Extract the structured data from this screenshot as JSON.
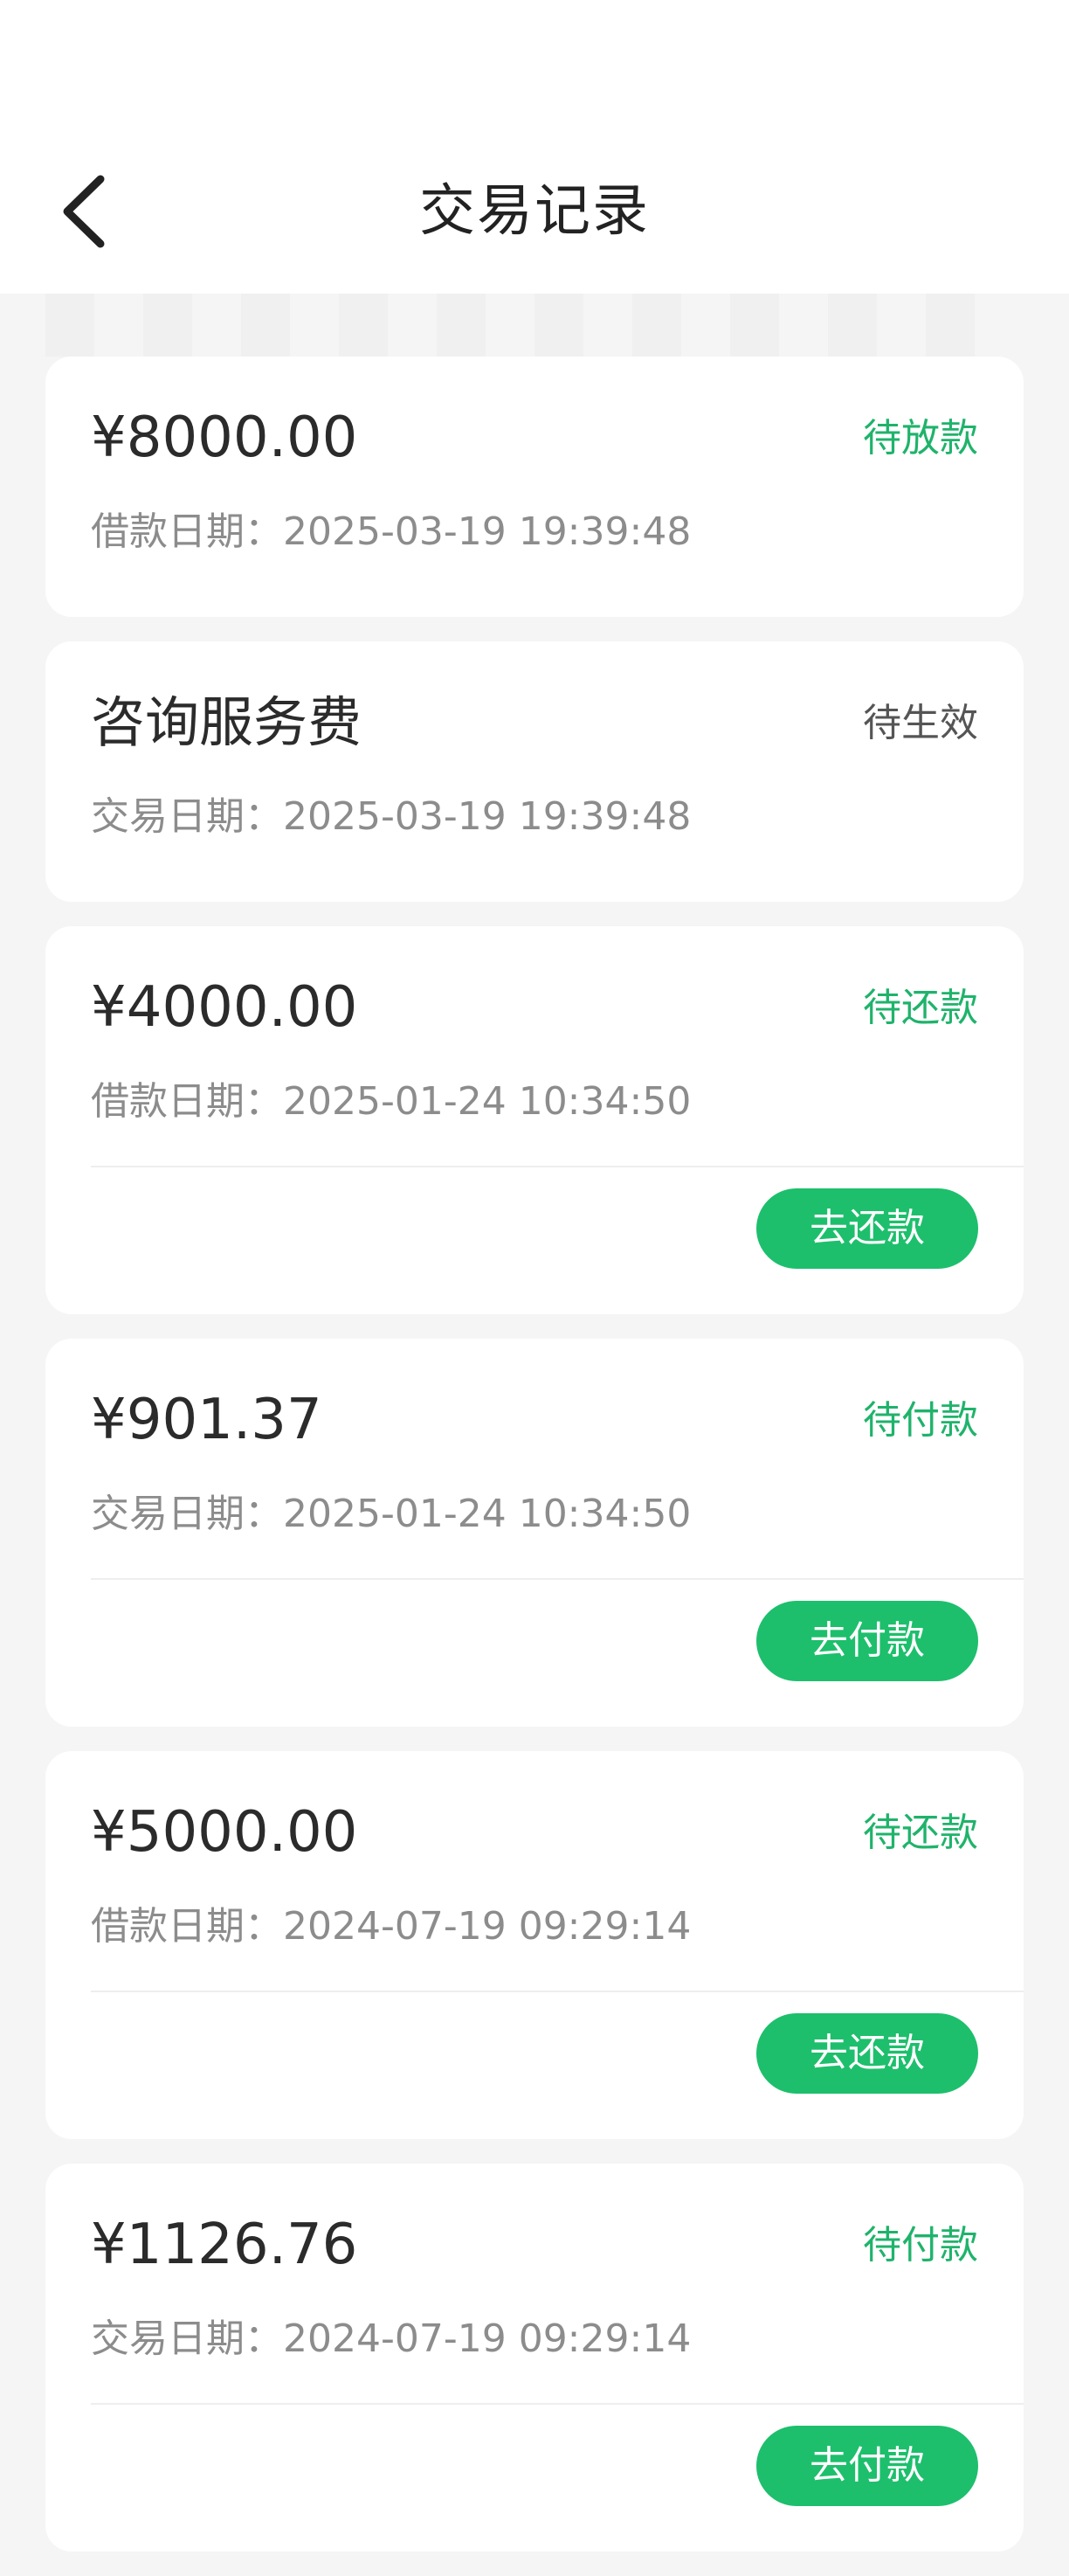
{
  "header": {
    "title": "交易记录",
    "back_icon": "chevron-left-icon"
  },
  "colors": {
    "accent": "#1dbf6c",
    "status_green": "#1fb36b",
    "status_gray": "#555555"
  },
  "records": [
    {
      "amount": "¥8000.00",
      "status": "待放款",
      "date_label": "借款日期：",
      "date": "2025-03-19 19:39:48"
    },
    {
      "amount": "咨询服务费",
      "status": "待生效",
      "date_label": "交易日期：",
      "date": "2025-03-19 19:39:48"
    },
    {
      "amount": "¥4000.00",
      "status": "待还款",
      "date_label": "借款日期：",
      "date": "2025-01-24 10:34:50",
      "action": "去还款"
    },
    {
      "amount": "¥901.37",
      "status": "待付款",
      "date_label": "交易日期：",
      "date": "2025-01-24 10:34:50",
      "action": "去付款"
    },
    {
      "amount": "¥5000.00",
      "status": "待还款",
      "date_label": "借款日期：",
      "date": "2024-07-19 09:29:14",
      "action": "去还款"
    },
    {
      "amount": "¥1126.76",
      "status": "待付款",
      "date_label": "交易日期：",
      "date": "2024-07-19 09:29:14",
      "action": "去付款"
    }
  ]
}
